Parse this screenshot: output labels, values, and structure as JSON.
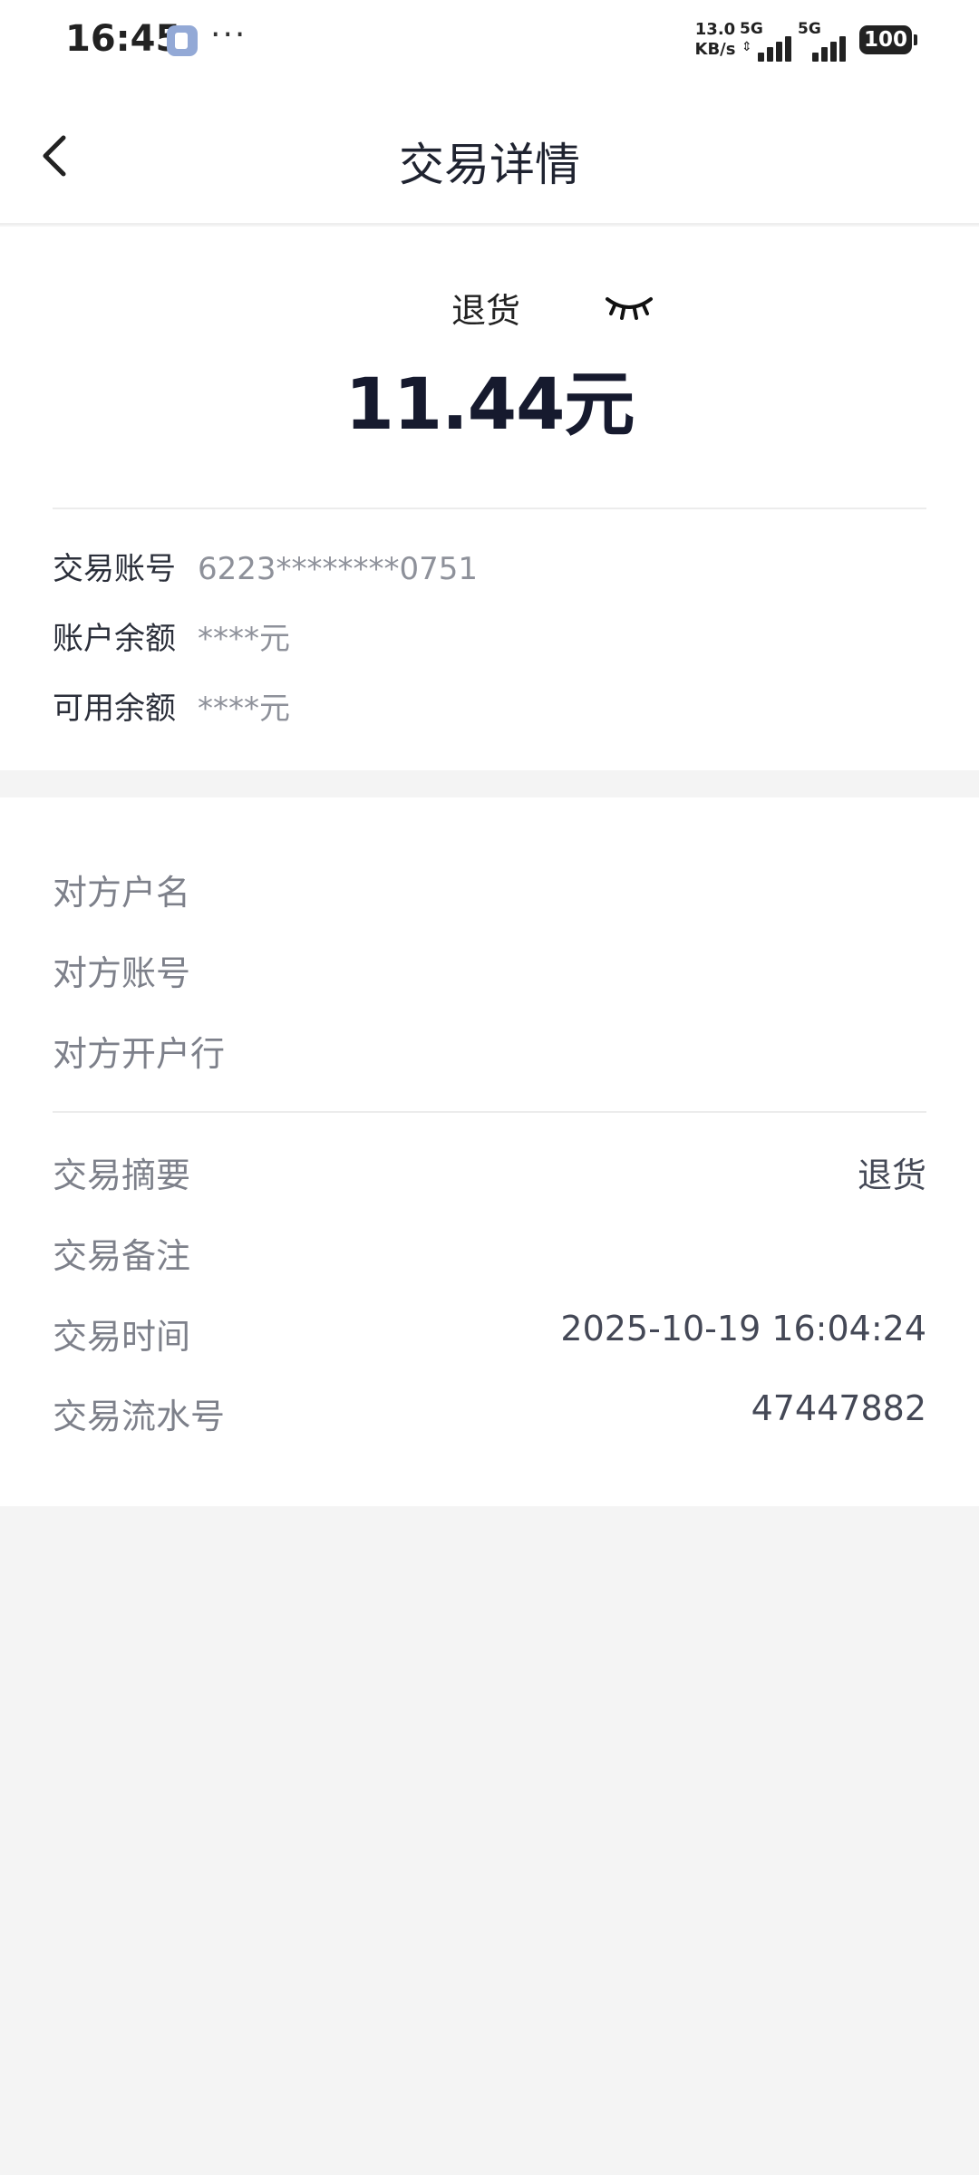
{
  "status_bar": {
    "time": "16:45",
    "dots": "···",
    "net_speed_value": "13.0",
    "net_speed_unit": "KB/s",
    "sim1_label": "5G",
    "sim2_label": "5G",
    "battery": "100"
  },
  "nav": {
    "title": "交易详情",
    "back_icon": "chevron-left-icon"
  },
  "summary": {
    "type": "退货",
    "amount": "11.44元",
    "eye_icon": "eye-closed-icon",
    "rows": [
      {
        "label": "交易账号",
        "value": "6223********0751"
      },
      {
        "label": "账户余额",
        "value": "****元"
      },
      {
        "label": "可用余额",
        "value": "****元"
      }
    ]
  },
  "counterparty": {
    "rows": [
      {
        "label": "对方户名",
        "value": ""
      },
      {
        "label": "对方账号",
        "value": ""
      },
      {
        "label": "对方开户行",
        "value": ""
      }
    ]
  },
  "details": {
    "rows": [
      {
        "label": "交易摘要",
        "value": "退货"
      },
      {
        "label": "交易备注",
        "value": ""
      },
      {
        "label": "交易时间",
        "value": "2025-10-19 16:04:24"
      },
      {
        "label": "交易流水号",
        "value": "47447882"
      }
    ]
  }
}
